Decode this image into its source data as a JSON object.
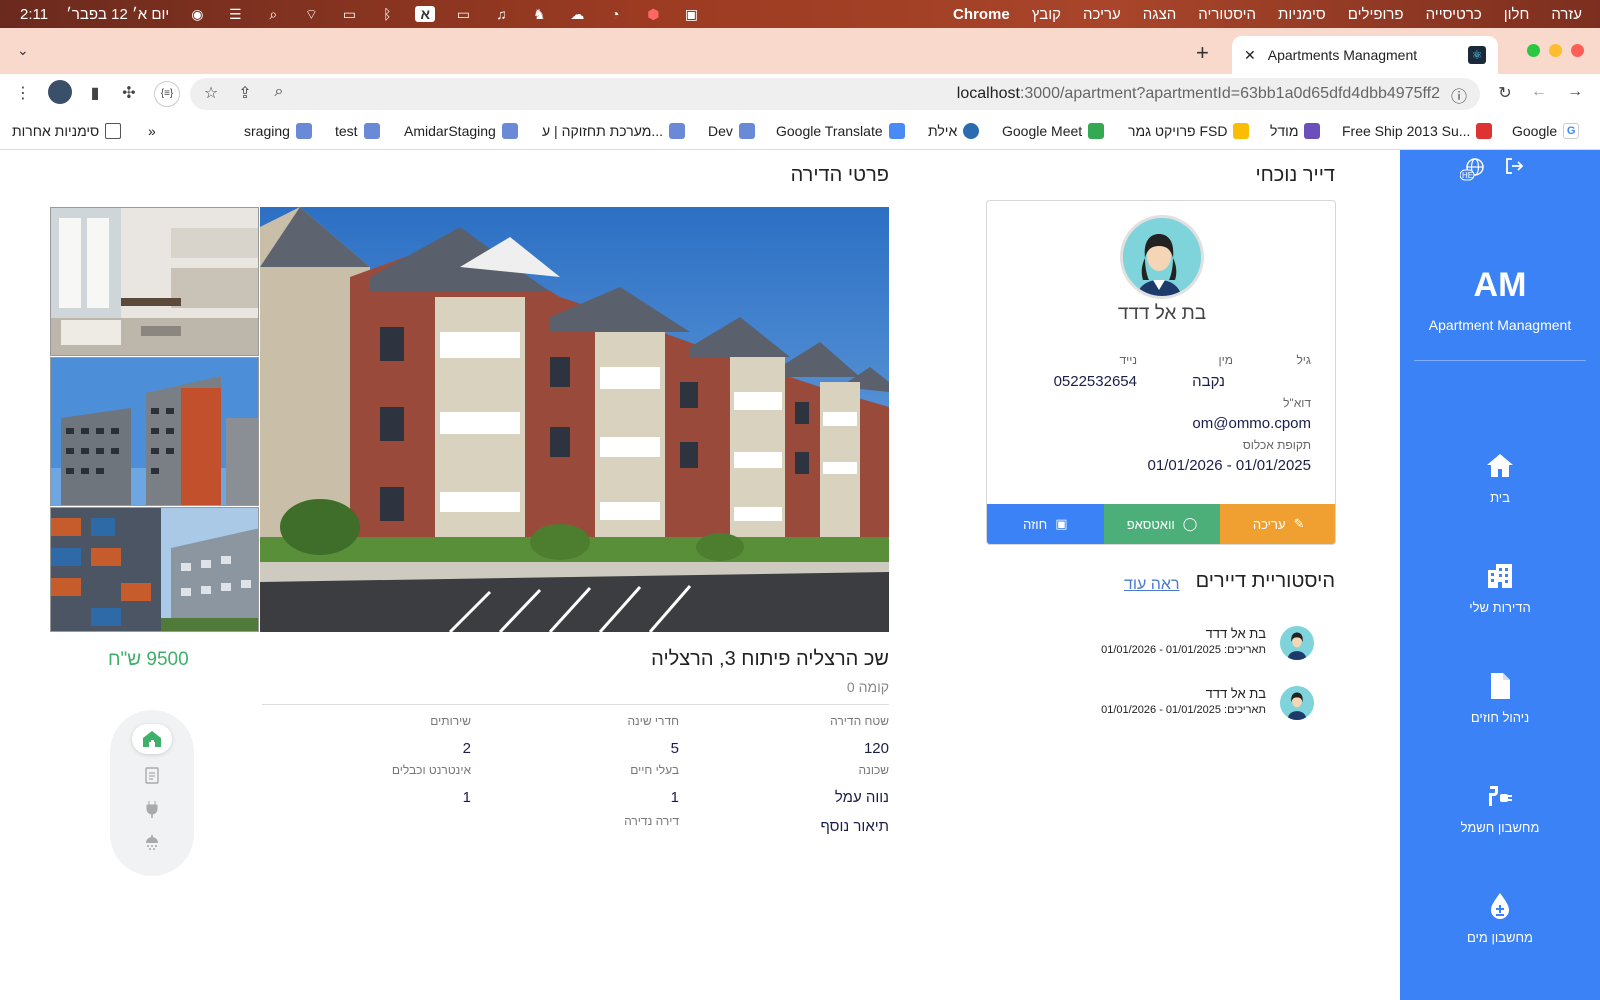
{
  "menubar": {
    "clock": "2:11",
    "date": "יום א׳ 12 בפבר׳",
    "app_name": "Chrome",
    "menu_items": [
      "קובץ",
      "עריכה",
      "הצגה",
      "היסטוריה",
      "סימניות",
      "פרופילים",
      "כרטיסייה",
      "חלון",
      "עזרה"
    ]
  },
  "browser": {
    "tab_title": "Apartments Managment",
    "url_host": "localhost",
    "url_rest": ":3000/apartment?apartmentId=63bb1a0d65dfd4dbb4975ff2",
    "bookmarks": [
      "Google",
      "Free Ship 2013 Su...",
      "מודל",
      "פרויקט גמר FSD",
      "Google Meet",
      "אילת",
      "Google Translate",
      "Dev",
      "מערכת תחזוקה | ע...",
      "AmidarStaging",
      "test",
      "sraging"
    ],
    "other_bookmarks": "סימניות אחרות",
    "overflow": "»"
  },
  "sidebar": {
    "lang_badge": "HE",
    "logo": "AM",
    "logo_sub": "Apartment Managment",
    "items": [
      {
        "label": "בית",
        "icon": "home-icon"
      },
      {
        "label": "הדירות שלי",
        "icon": "building-icon"
      },
      {
        "label": "ניהול חוזים",
        "icon": "document-icon"
      },
      {
        "label": "מחשבון חשמל",
        "icon": "plug-icon"
      },
      {
        "label": "מחשבון מים",
        "icon": "water-drop-icon"
      }
    ]
  },
  "tenant": {
    "section_title": "דייר נוכחי",
    "name": "בת אל דדד",
    "age_label": "גיל",
    "age_value": "",
    "gender_label": "מין",
    "gender_value": "נקבה",
    "phone_label": "נייד",
    "phone_value": "0522532654",
    "email_label": "דוא\"ל",
    "email_value": "om@ommo.cpom",
    "period_label": "תקופת אכלוס",
    "period_value": "01/01/2026 - 01/01/2025",
    "actions": {
      "edit": "עריכה",
      "whatsapp": "וואטסאפ",
      "contract": "חוזה"
    }
  },
  "history": {
    "title": "היסטוריית דיירים",
    "see_more": "ראה עוד",
    "rows": [
      {
        "name": "בת אל דדד",
        "dates": "תאריכים: 01/01/2025 - 01/01/2026"
      },
      {
        "name": "בת אל דדד",
        "dates": "תאריכים: 01/01/2025 - 01/01/2026"
      }
    ]
  },
  "apartment": {
    "section_title": "פרטי הדירה",
    "title": "שכ הרצליה פיתוח 3, הרצליה",
    "floor": "קומה 0",
    "price": "9500 ש\"ח",
    "fields": {
      "area_label": "שטח הדירה",
      "area_value": "120",
      "bedrooms_label": "חדרי שינה",
      "bedrooms_value": "5",
      "bathrooms_label": "שירותים",
      "bathrooms_value": "2",
      "neighborhood_label": "שכונה",
      "neighborhood_value": "נווה עמל",
      "pets_label": "בעלי חיים",
      "pets_value": "1",
      "internet_label": "אינטרנט וכבלים",
      "internet_value": "1",
      "rare_label": "דירה נדירה",
      "more_desc": "תיאור נוסף"
    }
  },
  "colors": {
    "sidebar": "#3b82f6",
    "contract_btn": "#3b82f6",
    "whatsapp_btn": "#4caf7a",
    "edit_btn": "#f0a030",
    "price": "#3fb06a"
  }
}
